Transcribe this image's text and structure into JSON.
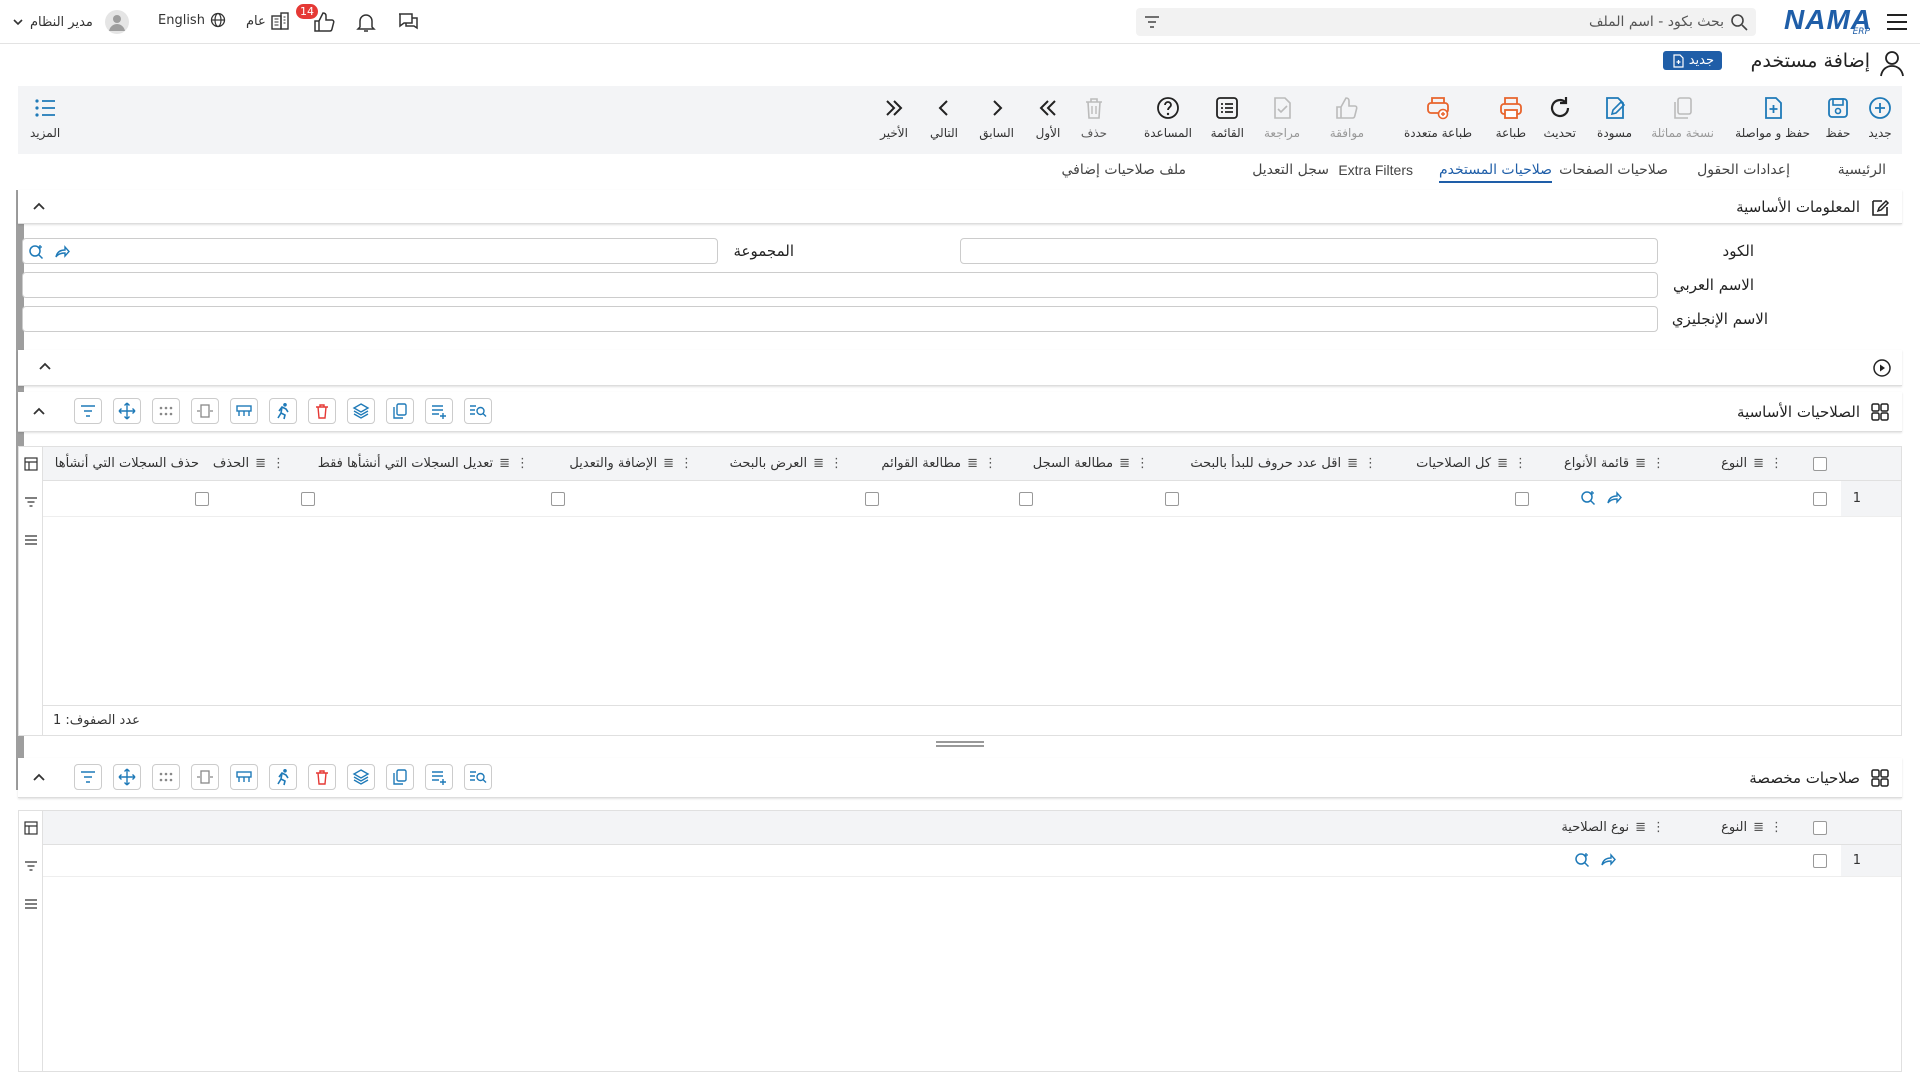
{
  "topbar": {
    "logo_text": "NAMA",
    "logo_sub": "ERP",
    "search_placeholder": "بحث بكود - اسم الملف",
    "notification_count": "14",
    "general_label": "عام",
    "language_label": "English",
    "user_name": "مدير النظام",
    "accent": "#1f5ea8"
  },
  "title": {
    "text": "إضافة مستخدم",
    "badge": "جديد"
  },
  "toolbar": {
    "new": "جديد",
    "save": "حفظ",
    "save_continue": "حفظ و مواصلة",
    "duplicate": "نسخة مماثلة",
    "draft": "مسودة",
    "refresh": "تحديث",
    "print": "طباعة",
    "multi_print": "طباعة متعددة",
    "approve": "موافقة",
    "review": "مراجعة",
    "list": "القائمة",
    "help": "المساعدة",
    "delete": "حذف",
    "first": "الأول",
    "previous": "السابق",
    "next": "التالي",
    "last": "الأخير",
    "more": "المزيد"
  },
  "tabs": {
    "main": "الرئيسية",
    "field_settings": "إعدادات الحقول",
    "page_permissions": "صلاحيات الصفحات",
    "user_permissions": "صلاحيات المستخدم",
    "extra_filters": "Extra Filters",
    "edit_log": "سجل التعديل",
    "extra_permissions_file": "ملف صلاحيات إضافي"
  },
  "basic_info": {
    "title": "المعلومات الأساسية",
    "code_label": "الكود",
    "group_label": "المجموعة",
    "arabic_name_label": "الاسم العربي",
    "english_name_label": "الاسم الإنجليزي"
  },
  "basic_permissions": {
    "title": "الصلاحيات الأساسية",
    "columns": {
      "type": "النوع",
      "types_list": "قائمة الأنواع",
      "all_permissions": "كل الصلاحيات",
      "min_chars": "اقل عدد حروف للبدأ بالبحث",
      "view_record": "مطالعة السجل",
      "view_lists": "مطالعة القوائم",
      "search_view": "العرض بالبحث",
      "add_edit": "الإضافة والتعديل",
      "edit_own": "تعديل السجلات التي أنشأها فقط",
      "delete": "الحذف",
      "delete_own": "حذف السجلات التي أنشأها"
    },
    "row_number": "1",
    "row_count_label": "عدد الصفوف: 1"
  },
  "custom_permissions": {
    "title": "صلاحيات مخصصة",
    "columns": {
      "type": "النوع",
      "permission_type": "نوع الصلاحية"
    },
    "row_number": "1"
  }
}
